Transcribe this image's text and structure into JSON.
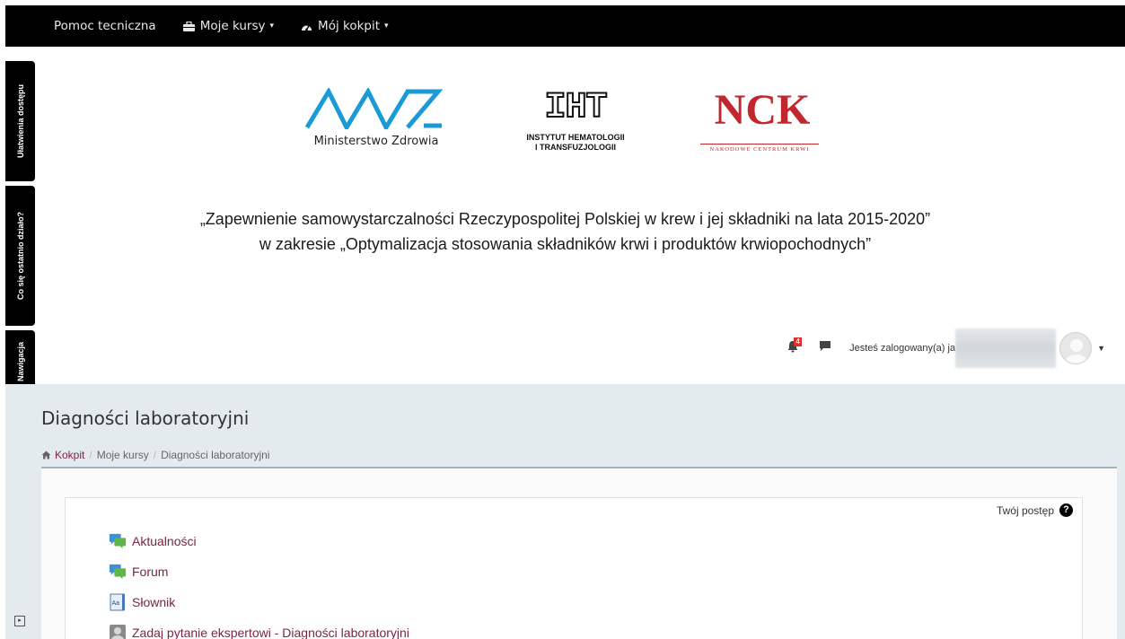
{
  "topnav": {
    "items": [
      {
        "label": "Pomoc tecniczna",
        "icon": "none"
      },
      {
        "label": "Moje kursy",
        "icon": "briefcase-icon"
      },
      {
        "label": "Mój kokpit",
        "icon": "dashboard-icon"
      }
    ]
  },
  "logos": {
    "mz_text": "Ministerstwo Zdrowia",
    "iht_mark": "IHT",
    "iht_line1": "INSTYTUT HEMATOLOGII",
    "iht_line2": "I TRANSFUZJOLOGII",
    "nck_mark": "NCK",
    "nck_text": "NARODOWE CENTRUM KRWI"
  },
  "tagline": {
    "line1": "„Zapewnienie samowystarczalności Rzeczypospolitej Polskiej w krew i jej składniki na lata 2015-2020”",
    "line2": "w zakresie „Optymalizacja stosowania składników krwi i produktów krwiopochodnych”"
  },
  "header_tools": {
    "notification_count": "4",
    "logged_in_text": "Jesteś zalogowany(a) jako"
  },
  "sidetabs": [
    "Ułatwienia dostępu",
    "Co się ostatnio działo?",
    "Nawigacja"
  ],
  "page": {
    "title": "Diagności laboratoryjni",
    "breadcrumb": [
      "Kokpit",
      "Moje kursy",
      "Diagności laboratoryjni"
    ],
    "progress_label": "Twój postęp",
    "help_glyph": "?",
    "activities": [
      {
        "label": "Aktualności",
        "icon": "forum-icon"
      },
      {
        "label": "Forum",
        "icon": "forum-icon"
      },
      {
        "label": "Słownik",
        "icon": "glossary-icon"
      },
      {
        "label": "Zadaj pytanie ekspertowi - Diagności laboratoryjni",
        "icon": "expert-icon"
      }
    ]
  },
  "colors": {
    "topbar": "#000000",
    "page_bg": "#e4ebee",
    "link": "#7a2448",
    "mz_blue": "#1a9ad6",
    "nck_red": "#c1272d",
    "badge_red": "#d9312a"
  }
}
